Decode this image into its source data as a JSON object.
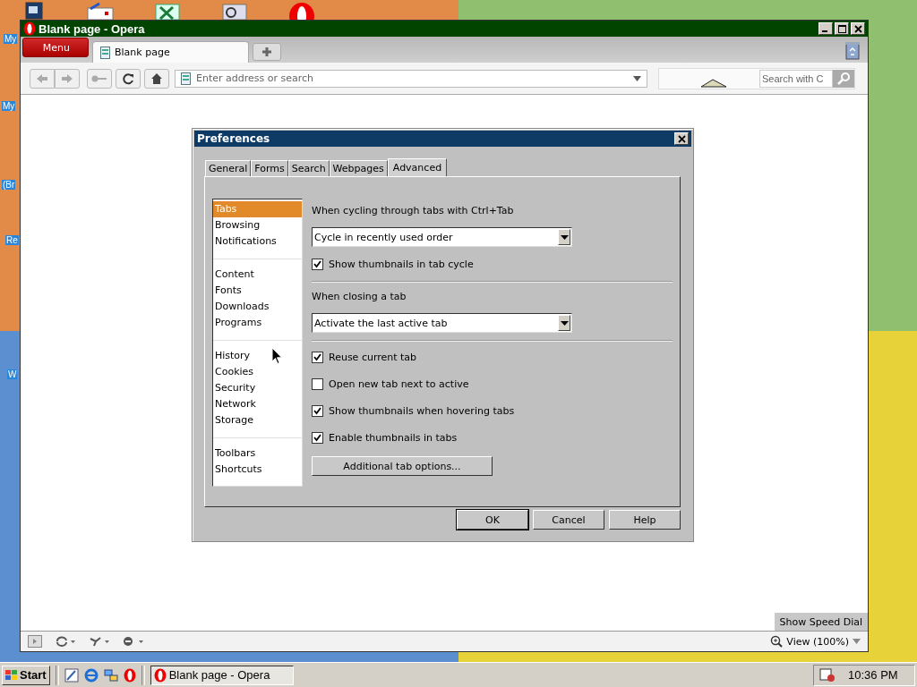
{
  "desktop": {
    "labels": [
      "My",
      "My",
      "(Br",
      "Re",
      "W"
    ]
  },
  "browser": {
    "title": "Blank page - Opera",
    "menu_button": "Menu",
    "tabs": [
      {
        "label": "Blank page",
        "selected": true
      }
    ],
    "address": {
      "placeholder": "Enter address or search"
    },
    "search": {
      "placeholder": "Search with C"
    },
    "speed_dial_button": "Show Speed Dial",
    "zoom": "View (100%)"
  },
  "dialog": {
    "title": "Preferences",
    "tabs": [
      {
        "label": "General",
        "selected": false
      },
      {
        "label": "Forms",
        "selected": false
      },
      {
        "label": "Search",
        "selected": false
      },
      {
        "label": "Webpages",
        "selected": false
      },
      {
        "label": "Advanced",
        "selected": true
      }
    ],
    "sidebar": {
      "groups": [
        [
          {
            "label": "Tabs",
            "selected": true
          },
          {
            "label": "Browsing",
            "selected": false
          },
          {
            "label": "Notifications",
            "selected": false
          }
        ],
        [
          {
            "label": "Content",
            "selected": false
          },
          {
            "label": "Fonts",
            "selected": false
          },
          {
            "label": "Downloads",
            "selected": false
          },
          {
            "label": "Programs",
            "selected": false
          }
        ],
        [
          {
            "label": "History",
            "selected": false
          },
          {
            "label": "Cookies",
            "selected": false
          },
          {
            "label": "Security",
            "selected": false
          },
          {
            "label": "Network",
            "selected": false
          },
          {
            "label": "Storage",
            "selected": false
          }
        ],
        [
          {
            "label": "Toolbars",
            "selected": false
          },
          {
            "label": "Shortcuts",
            "selected": false
          }
        ]
      ]
    },
    "items": [
      {
        "kind": "heading",
        "label": "When cycling through tabs with Ctrl+Tab"
      },
      {
        "kind": "dropdown",
        "value": "Cycle in recently used order"
      },
      {
        "kind": "checkbox",
        "label": "Show thumbnails in tab cycle",
        "checked": true
      },
      {
        "kind": "divider"
      },
      {
        "kind": "heading",
        "label": "When closing a tab"
      },
      {
        "kind": "dropdown",
        "value": "Activate the last active tab"
      },
      {
        "kind": "divider"
      },
      {
        "kind": "checkbox",
        "label": "Reuse current tab",
        "checked": true
      },
      {
        "kind": "checkbox",
        "label": "Open new tab next to active",
        "checked": false
      },
      {
        "kind": "checkbox",
        "label": "Show thumbnails when hovering tabs",
        "checked": true
      },
      {
        "kind": "checkbox",
        "label": "Enable thumbnails in tabs",
        "checked": true
      },
      {
        "kind": "button",
        "label": "Additional tab options..."
      }
    ],
    "buttons": [
      "OK",
      "Cancel",
      "Help"
    ]
  },
  "taskbar": {
    "start": "Start",
    "tasks": [
      {
        "label": "Blank page - Opera",
        "selected": true
      }
    ],
    "clock": "10:36 PM"
  }
}
